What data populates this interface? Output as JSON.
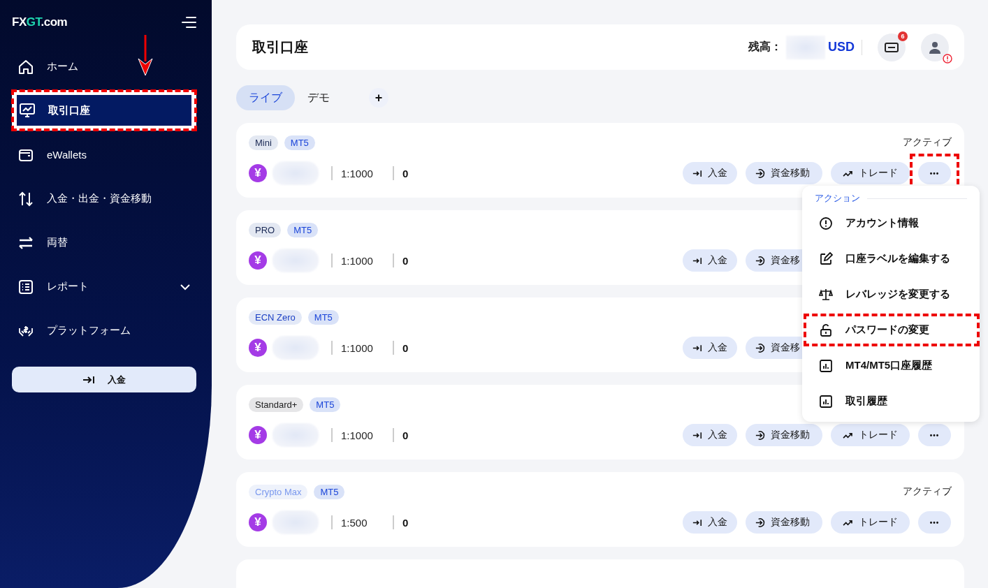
{
  "sidebar": {
    "logo": {
      "prefix": "FX",
      "accent": "GT",
      "suffix": ".com"
    },
    "items": [
      {
        "label": "ホーム",
        "kind": "home",
        "selected": false,
        "highlighted": false
      },
      {
        "label": "取引口座",
        "kind": "monitor",
        "selected": true,
        "highlighted": true
      },
      {
        "label": "eWallets",
        "kind": "wallet",
        "selected": false,
        "highlighted": false
      },
      {
        "label": "入金・出金・資金移動",
        "kind": "updown",
        "selected": false,
        "highlighted": false
      },
      {
        "label": "両替",
        "kind": "swap",
        "selected": false,
        "highlighted": false
      },
      {
        "label": "レポート",
        "kind": "report",
        "selected": false,
        "highlighted": false,
        "expandable": true
      },
      {
        "label": "プラットフォーム",
        "kind": "hands",
        "selected": false,
        "highlighted": false
      }
    ],
    "deposit_button": "入金"
  },
  "header": {
    "title": "取引口座",
    "balance_label": "残高：",
    "currency": "USD",
    "notification_count": "6"
  },
  "tabs": [
    {
      "label": "ライブ",
      "selected": true
    },
    {
      "label": "デモ",
      "selected": false
    }
  ],
  "add_tab": "+",
  "accounts": [
    {
      "plan": {
        "label": "Mini",
        "kind": "default"
      },
      "platform": "MT5",
      "currency_symbol": "¥",
      "leverage": "1:1000",
      "balance": "0",
      "status": "アクティブ",
      "actions": [
        {
          "kind": "deposit",
          "label": "入金"
        },
        {
          "kind": "transfer",
          "label": "資金移動"
        },
        {
          "kind": "trade",
          "label": "トレード"
        },
        {
          "kind": "more",
          "label": "•••",
          "highlighted": true
        }
      ]
    },
    {
      "plan": {
        "label": "PRO",
        "kind": "default"
      },
      "platform": "MT5",
      "currency_symbol": "¥",
      "leverage": "1:1000",
      "balance": "0",
      "actions": [
        {
          "kind": "deposit",
          "label": "入金"
        },
        {
          "kind": "transfer",
          "label": "資金移"
        }
      ]
    },
    {
      "plan": {
        "label": "ECN Zero",
        "kind": "accent"
      },
      "platform": "MT5",
      "currency_symbol": "¥",
      "leverage": "1:1000",
      "balance": "0",
      "actions": [
        {
          "kind": "deposit",
          "label": "入金"
        },
        {
          "kind": "transfer",
          "label": "資金移"
        }
      ]
    },
    {
      "plan": {
        "label": "Standard+",
        "kind": "neutral"
      },
      "platform": "MT5",
      "currency_symbol": "¥",
      "leverage": "1:1000",
      "balance": "0",
      "actions": [
        {
          "kind": "deposit",
          "label": "入金"
        },
        {
          "kind": "transfer",
          "label": "資金移動"
        },
        {
          "kind": "trade",
          "label": "トレード"
        },
        {
          "kind": "more",
          "label": "•••",
          "highlighted": false
        }
      ]
    },
    {
      "plan": {
        "label": "Crypto Max",
        "kind": "muted"
      },
      "platform": "MT5",
      "currency_symbol": "¥",
      "leverage": "1:500",
      "balance": "0",
      "status": "アクティブ",
      "actions": [
        {
          "kind": "deposit",
          "label": "入金"
        },
        {
          "kind": "transfer",
          "label": "資金移動"
        },
        {
          "kind": "trade",
          "label": "トレード"
        },
        {
          "kind": "more",
          "label": "•••",
          "highlighted": false
        }
      ]
    }
  ],
  "action_menu": {
    "heading": "アクション",
    "items": [
      {
        "label": "アカウント情報",
        "kind": "info",
        "highlighted": false
      },
      {
        "label": "口座ラベルを編集する",
        "kind": "edit",
        "highlighted": false
      },
      {
        "label": "レバレッジを変更する",
        "kind": "scale",
        "highlighted": false
      },
      {
        "label": "パスワードの変更",
        "kind": "lock",
        "highlighted": true
      },
      {
        "label": "MT4/MT5口座履歴",
        "kind": "chart",
        "highlighted": false
      },
      {
        "label": "取引履歴",
        "kind": "chart",
        "highlighted": false
      }
    ]
  }
}
